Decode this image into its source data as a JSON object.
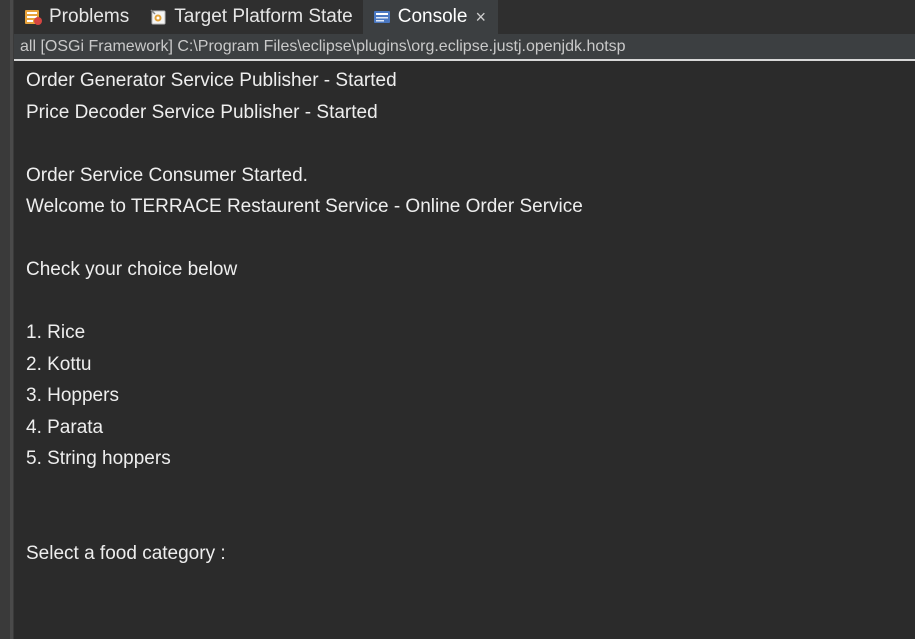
{
  "tabs": [
    {
      "label": "Problems",
      "icon": "problems-icon",
      "active": false
    },
    {
      "label": "Target Platform State",
      "icon": "target-platform-icon",
      "active": false
    },
    {
      "label": "Console",
      "icon": "console-icon",
      "active": true
    }
  ],
  "close_glyph": "×",
  "launch_path": "all [OSGi Framework] C:\\Program Files\\eclipse\\plugins\\org.eclipse.justj.openjdk.hotsp",
  "console_lines": [
    "Order Generator Service Publisher - Started",
    "Price Decoder Service Publisher - Started",
    "",
    "Order Service Consumer Started.",
    "Welcome to TERRACE Restaurent Service - Online Order Service",
    "",
    "Check your choice below",
    "",
    "1. Rice",
    "2. Kottu",
    "3. Hoppers",
    "4. Parata",
    "5. String hoppers",
    "",
    "",
    "Select a food category :"
  ],
  "colors": {
    "background": "#2b2b2b",
    "active_tab": "#3c3f41",
    "text": "#eeeeee"
  }
}
